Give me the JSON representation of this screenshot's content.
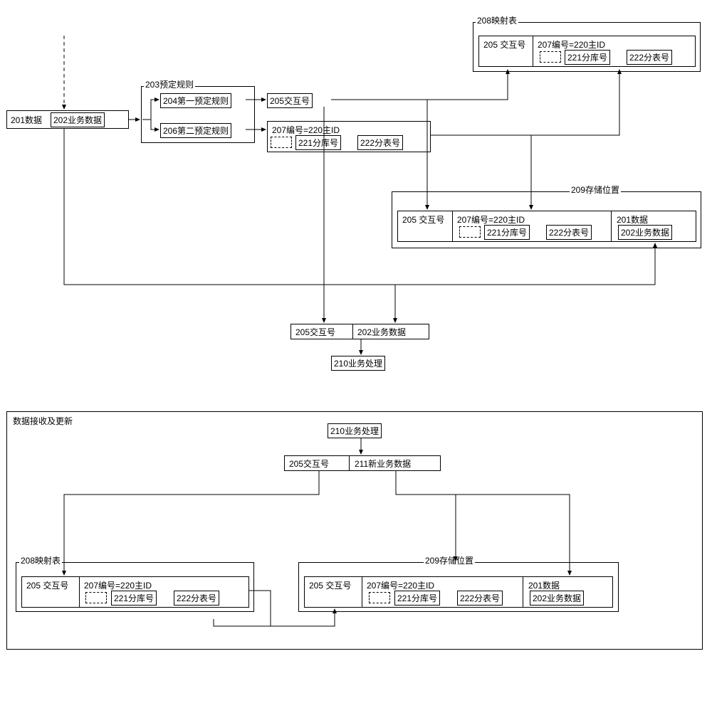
{
  "upper": {
    "data201": "201数据",
    "biz202": "202业务数据",
    "rules203_label": "203预定规则",
    "rule204": "204第一预定规则",
    "rule206": "206第二预定规则",
    "inter205": "205交互号",
    "code207_container_label": "207编号=220主ID",
    "sub221": "221分库号",
    "sub222": "222分表号",
    "map208_label": "208映射表",
    "map208_inter205": "205 交互号",
    "map208_code207_label": "207编号=220主ID",
    "map208_sub221": "221分库号",
    "map208_sub222": "222分表号",
    "store209_label": "209存储位置",
    "store209_inter205": "205 交互号",
    "store209_code207_label": "207编号=220主ID",
    "store209_sub221": "221分库号",
    "store209_sub222": "222分表号",
    "store209_data201": "201数据",
    "store209_biz202": "202业务数据",
    "mid_inter205": "205交互号",
    "mid_biz202": "202业务数据",
    "proc210": "210业务处理"
  },
  "lower": {
    "section_label": "数据接收及更新",
    "proc210": "210业务处理",
    "inter205": "205交互号",
    "newbiz211": "211新业务数据",
    "map208_label": "208映射表",
    "map_inter205": "205 交互号",
    "map_code207_label": "207编号=220主ID",
    "map_sub221": "221分库号",
    "map_sub222": "222分表号",
    "store209_label": "209存储位置",
    "store_inter205": "205 交互号",
    "store_code207_label": "207编号=220主ID",
    "store_sub221": "221分库号",
    "store_sub222": "222分表号",
    "store_data201": "201数据",
    "store_biz202": "202业务数据"
  }
}
